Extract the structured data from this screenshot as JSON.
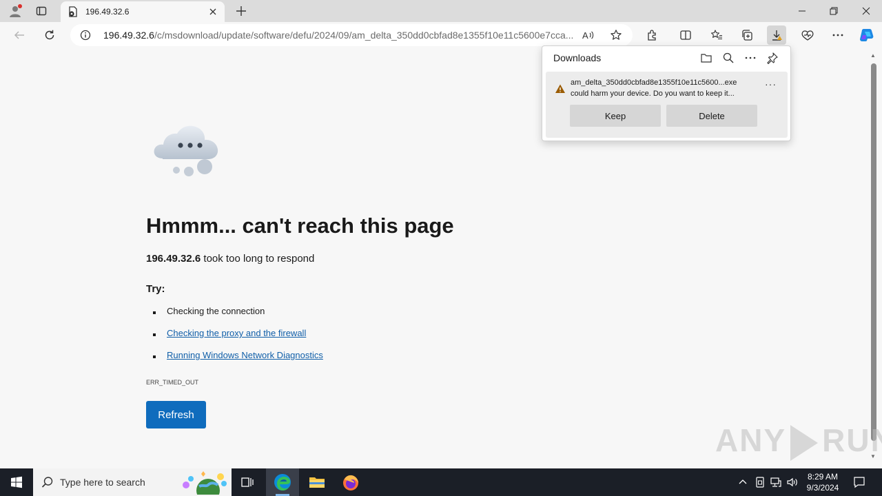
{
  "browser": {
    "tab_title": "196.49.32.6",
    "url_host": "196.49.32.6",
    "url_path": "/c/msdownload/update/software/defu/2024/09/am_delta_350dd0cbfad8e1355f10e11c5600e7cca..."
  },
  "page": {
    "heading": "Hmmm... can't reach this page",
    "host": "196.49.32.6",
    "subtitle_rest": " took too long to respond",
    "try_label": "Try:",
    "tips": [
      "Checking the connection",
      "Checking the proxy and the firewall",
      "Running Windows Network Diagnostics"
    ],
    "error_code": "ERR_TIMED_OUT",
    "refresh_label": "Refresh"
  },
  "downloads": {
    "title": "Downloads",
    "file_name": "am_delta_350dd0cbfad8e1355f10e11c5600...exe",
    "warning": "could harm your device. Do you want to keep it...",
    "keep_label": "Keep",
    "delete_label": "Delete"
  },
  "watermark": {
    "left": "ANY",
    "right": "RUN"
  },
  "taskbar": {
    "search_placeholder": "Type here to search",
    "time": "8:29 AM",
    "date": "9/3/2024"
  }
}
